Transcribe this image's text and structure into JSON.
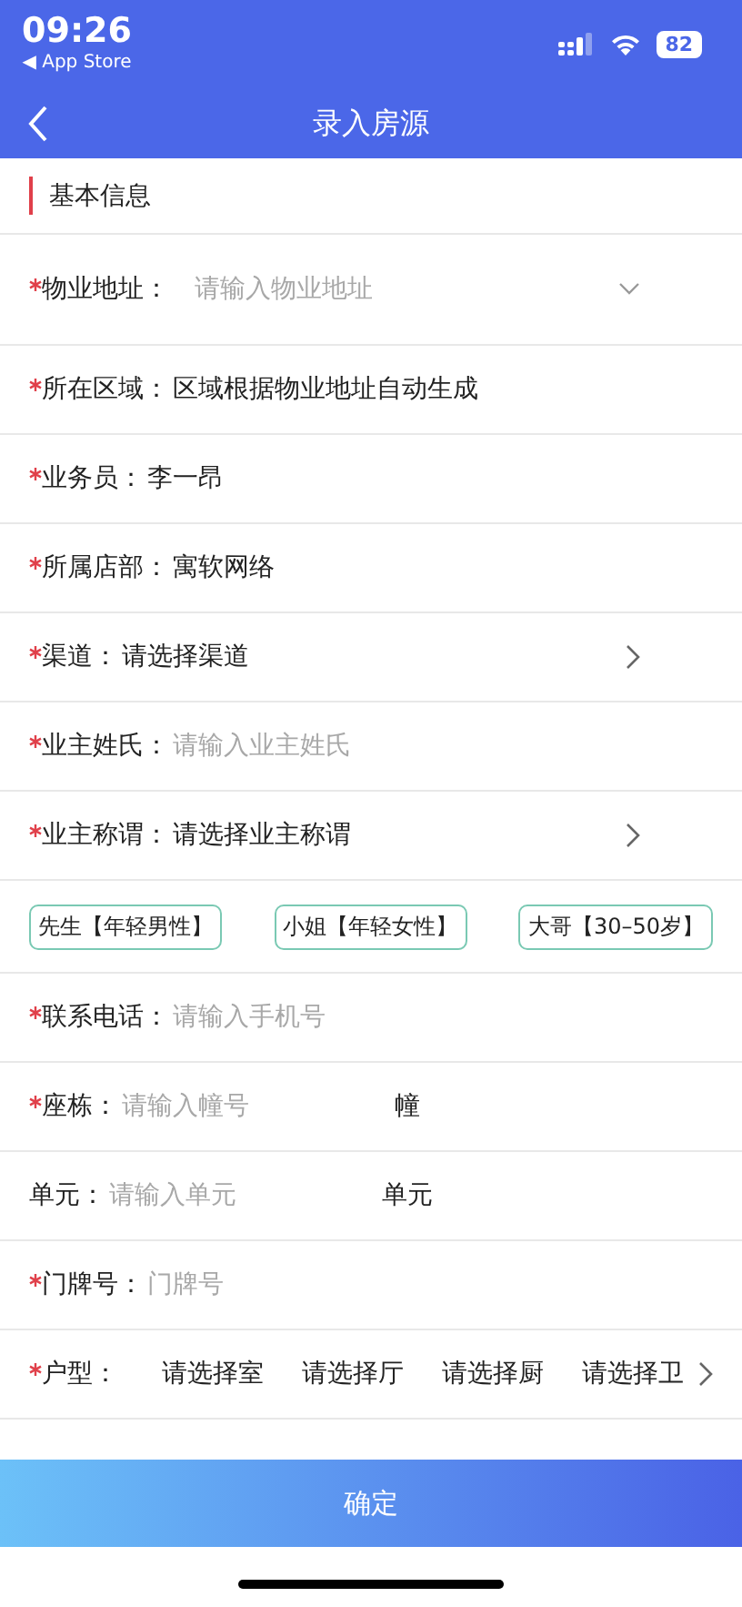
{
  "status_bar": {
    "time": "09:26",
    "back_app": "◀ App Store",
    "battery": "82"
  },
  "nav": {
    "title": "录入房源"
  },
  "section": {
    "title": "基本信息"
  },
  "rows": [
    {
      "kind": "input",
      "required": true,
      "label": "物业地址：",
      "placeholder": "请输入物业地址",
      "dropdown": true
    },
    {
      "kind": "text",
      "required": true,
      "label": "所在区域：",
      "value": "区域根据物业地址自动生成"
    },
    {
      "kind": "text",
      "required": true,
      "label": "业务员：",
      "value": "李一昂"
    },
    {
      "kind": "text",
      "required": true,
      "label": "所属店部：",
      "value": "寓软网络"
    },
    {
      "kind": "text",
      "required": true,
      "label": "渠道：",
      "value": "请选择渠道",
      "navigable": true
    },
    {
      "kind": "input",
      "required": true,
      "label": "业主姓氏：",
      "placeholder": "请输入业主姓氏"
    },
    {
      "kind": "text",
      "required": true,
      "label": "业主称谓：",
      "value": "请选择业主称谓",
      "navigable": true
    },
    {
      "kind": "tags",
      "tags": [
        "先生【年轻男性】",
        "小姐【年轻女性】",
        "大哥【30–50岁】"
      ]
    },
    {
      "kind": "input",
      "required": true,
      "label": "联系电话：",
      "placeholder": "请输入手机号"
    },
    {
      "kind": "input",
      "required": true,
      "label": "座栋：",
      "placeholder": "请输入幢号",
      "suffix": "幢"
    },
    {
      "kind": "input",
      "required": false,
      "label": "单元：",
      "placeholder": "请输入单元",
      "suffix": "单元"
    },
    {
      "kind": "input",
      "required": true,
      "label": "门牌号：",
      "placeholder": "门牌号"
    },
    {
      "kind": "multi",
      "required": true,
      "label": "户型：",
      "options": [
        "请选择室",
        "请选择厅",
        "请选择厨",
        "请选择卫"
      ],
      "navigable": true
    }
  ],
  "confirm_button": "确定"
}
